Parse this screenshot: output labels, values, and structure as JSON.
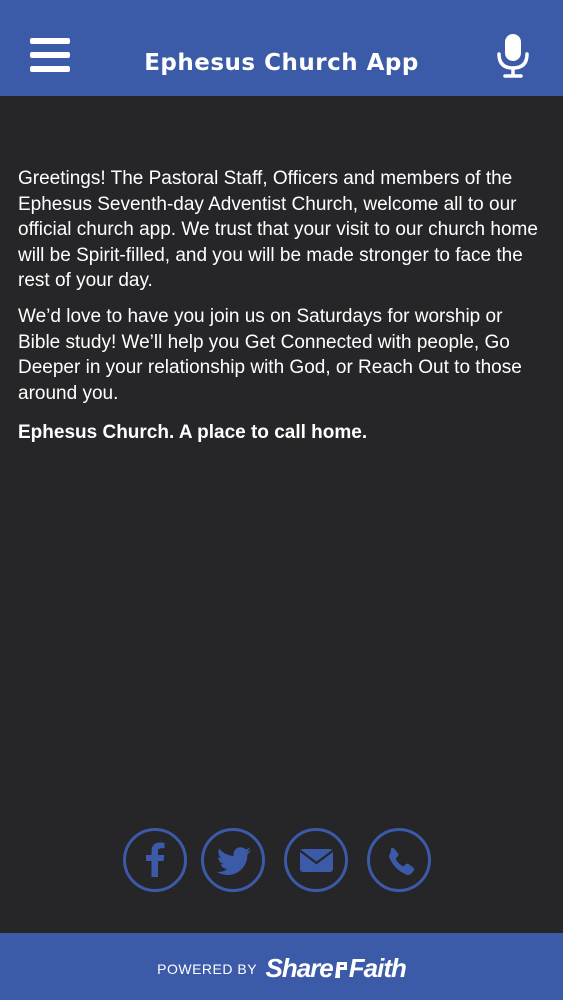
{
  "header": {
    "title": "Ephesus Church App",
    "menu_icon": "hamburger-menu-icon",
    "mic_icon": "microphone-icon"
  },
  "content": {
    "paragraph1": "Greetings! The Pastoral Staff, Officers and members of the Ephesus Seventh-day Adventist Church, welcome all to our official church app.  We trust that your visit to our church home will be Spirit-filled, and you will be made stronger to face the rest of your day.",
    "paragraph2": "We’d love to have you join us on Saturdays for worship or Bible study! We’ll help you Get Connected with people, Go Deeper in your relationship with God, or Reach Out to those around you.",
    "tagline": "Ephesus Church.  A place to call home."
  },
  "social": [
    {
      "icon": "facebook-icon"
    },
    {
      "icon": "twitter-icon"
    },
    {
      "icon": "email-icon"
    },
    {
      "icon": "phone-icon"
    }
  ],
  "footer": {
    "powered_by": "POWERED BY",
    "brand_part1": "Share",
    "brand_part2": "Faith"
  },
  "colors": {
    "brand_blue": "#3b5aa8",
    "background": "#262527",
    "text": "#ffffff"
  }
}
